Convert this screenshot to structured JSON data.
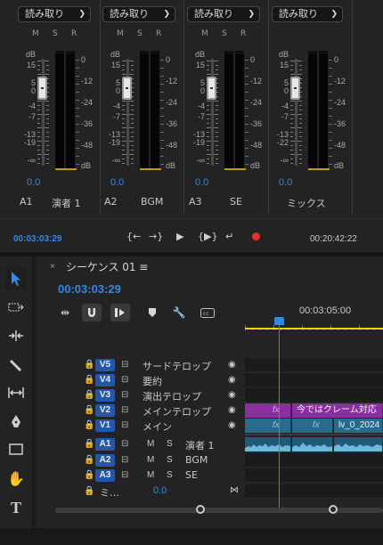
{
  "mixer": {
    "channels": [
      {
        "mode": "読み取り",
        "m": "M",
        "s": "S",
        "r": "R",
        "label": "A1",
        "name": "演者 1",
        "value": "0.0"
      },
      {
        "mode": "読み取り",
        "m": "M",
        "s": "S",
        "r": "R",
        "label": "A2",
        "name": "BGM",
        "value": "0.0"
      },
      {
        "mode": "読み取り",
        "m": "M",
        "s": "S",
        "r": "R",
        "label": "A3",
        "name": "SE",
        "value": "0.0"
      },
      {
        "mode": "読み取り",
        "m": "M",
        "s": "S",
        "r": "R",
        "label": "",
        "name": "ミックス",
        "value": "0.0"
      }
    ],
    "fader_scale": [
      "dB",
      "15",
      "5",
      "0",
      "-4",
      "-7",
      "-13",
      "-19",
      "-∞"
    ],
    "master_fader_scale": [
      "dB",
      "15",
      "5",
      "0",
      "-4",
      "-7",
      "-13",
      "-22",
      "-∞"
    ],
    "meter_scale": [
      "0",
      "-12",
      "-24",
      "-36",
      "-48",
      "dB"
    ],
    "transport": {
      "current_time": "00:03:03:29",
      "duration": "00:20:42:22",
      "buttons": [
        "{←",
        "→}",
        "▶",
        "{▶}",
        "↵"
      ]
    }
  },
  "tools": [
    "selection-tool",
    "track-select-tool",
    "ripple-edit-tool",
    "razor-tool",
    "slip-tool",
    "pen-tool",
    "rectangle-tool",
    "hand-tool",
    "type-tool"
  ],
  "sequence": {
    "close": "×",
    "title": "シーケンス 01 ≡",
    "timecode": "00:03:03:29",
    "ruler_timecode": "00:03:05:00",
    "video_tracks": [
      {
        "id": "V5",
        "name": "サードテロップ"
      },
      {
        "id": "V4",
        "name": "要約"
      },
      {
        "id": "V3",
        "name": "演出テロップ"
      },
      {
        "id": "V2",
        "name": "メインテロップ"
      },
      {
        "id": "V1",
        "name": "メイン"
      }
    ],
    "audio_tracks": [
      {
        "id": "A1",
        "m": "M",
        "s": "S",
        "name": "演者 1"
      },
      {
        "id": "A2",
        "m": "M",
        "s": "S",
        "name": "BGM"
      },
      {
        "id": "A3",
        "m": "M",
        "s": "S",
        "name": "SE"
      }
    ],
    "mix_track": {
      "name": "ミ…",
      "value": "0.0"
    },
    "clips": {
      "v2_fx": "fx",
      "v2_title": "今ではクレーム対応",
      "v1_fx": "fx",
      "v1_name": "lv_0_2024"
    }
  }
}
